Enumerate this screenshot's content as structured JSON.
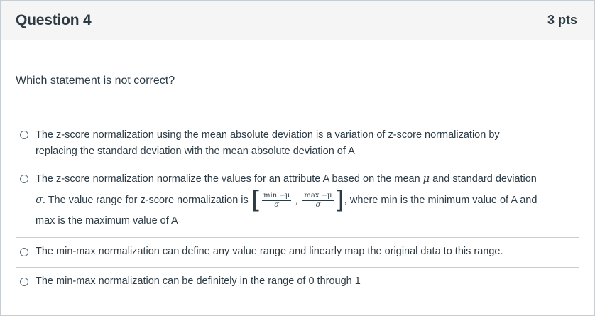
{
  "question": {
    "title": "Question 4",
    "points": "3 pts",
    "text": "Which statement is not correct?"
  },
  "answers": [
    {
      "line1": "The z-score normalization using the mean absolute deviation is a variation of z-score normalization by",
      "line2": "replacing the standard deviation with the mean absolute deviation of A"
    },
    {
      "line1_pre": "The z-score normalization normalize the values for an attribute A based on the mean ",
      "mu": "μ",
      "line1_post": " and standard deviation",
      "sigma": "σ",
      "line2_pre": ". The value range for z-score normalization is ",
      "frac1_num": "min −μ",
      "frac1_den": "σ",
      "frac2_num": "max −μ",
      "frac2_den": "σ",
      "bracket_open": "[",
      "comma": ",",
      "bracket_close": "]",
      "line2_post": ", where min is the minimum value of A and",
      "line3": "max is the maximum value of A"
    },
    {
      "line1": "The min-max normalization can define any value range and linearly map the original data to this range."
    },
    {
      "line1": "The min-max normalization can be definitely in the range of 0 through 1"
    }
  ]
}
